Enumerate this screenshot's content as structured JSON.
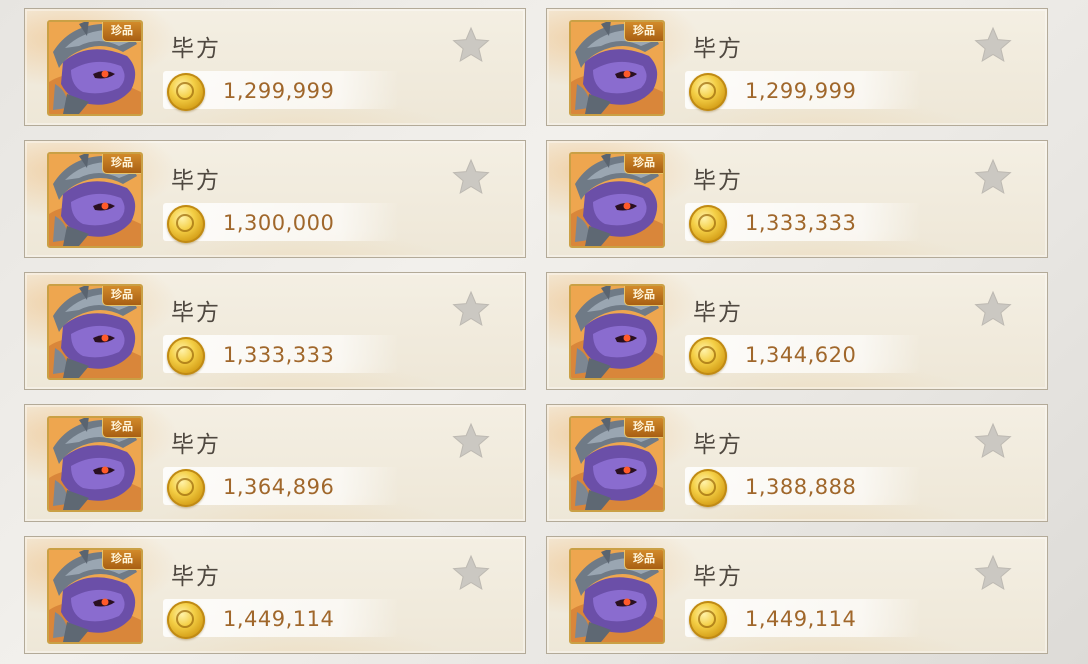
{
  "badge_label": "珍品",
  "icons": {
    "currency": "gold-coin-icon",
    "favorite": "star-icon",
    "portrait": "armored-beast-portrait"
  },
  "colors": {
    "price_text": "#a0672b",
    "badge_bg": "#b8701b",
    "star": "#c9c6c0",
    "card_border": "#b3aa98"
  },
  "listings": [
    {
      "name": "毕方",
      "price": "1,299,999",
      "badge": "珍品"
    },
    {
      "name": "毕方",
      "price": "1,299,999",
      "badge": "珍品"
    },
    {
      "name": "毕方",
      "price": "1,300,000",
      "badge": "珍品"
    },
    {
      "name": "毕方",
      "price": "1,333,333",
      "badge": "珍品"
    },
    {
      "name": "毕方",
      "price": "1,333,333",
      "badge": "珍品"
    },
    {
      "name": "毕方",
      "price": "1,344,620",
      "badge": "珍品"
    },
    {
      "name": "毕方",
      "price": "1,364,896",
      "badge": "珍品"
    },
    {
      "name": "毕方",
      "price": "1,388,888",
      "badge": "珍品"
    },
    {
      "name": "毕方",
      "price": "1,449,114",
      "badge": "珍品"
    },
    {
      "name": "毕方",
      "price": "1,449,114",
      "badge": "珍品"
    }
  ]
}
